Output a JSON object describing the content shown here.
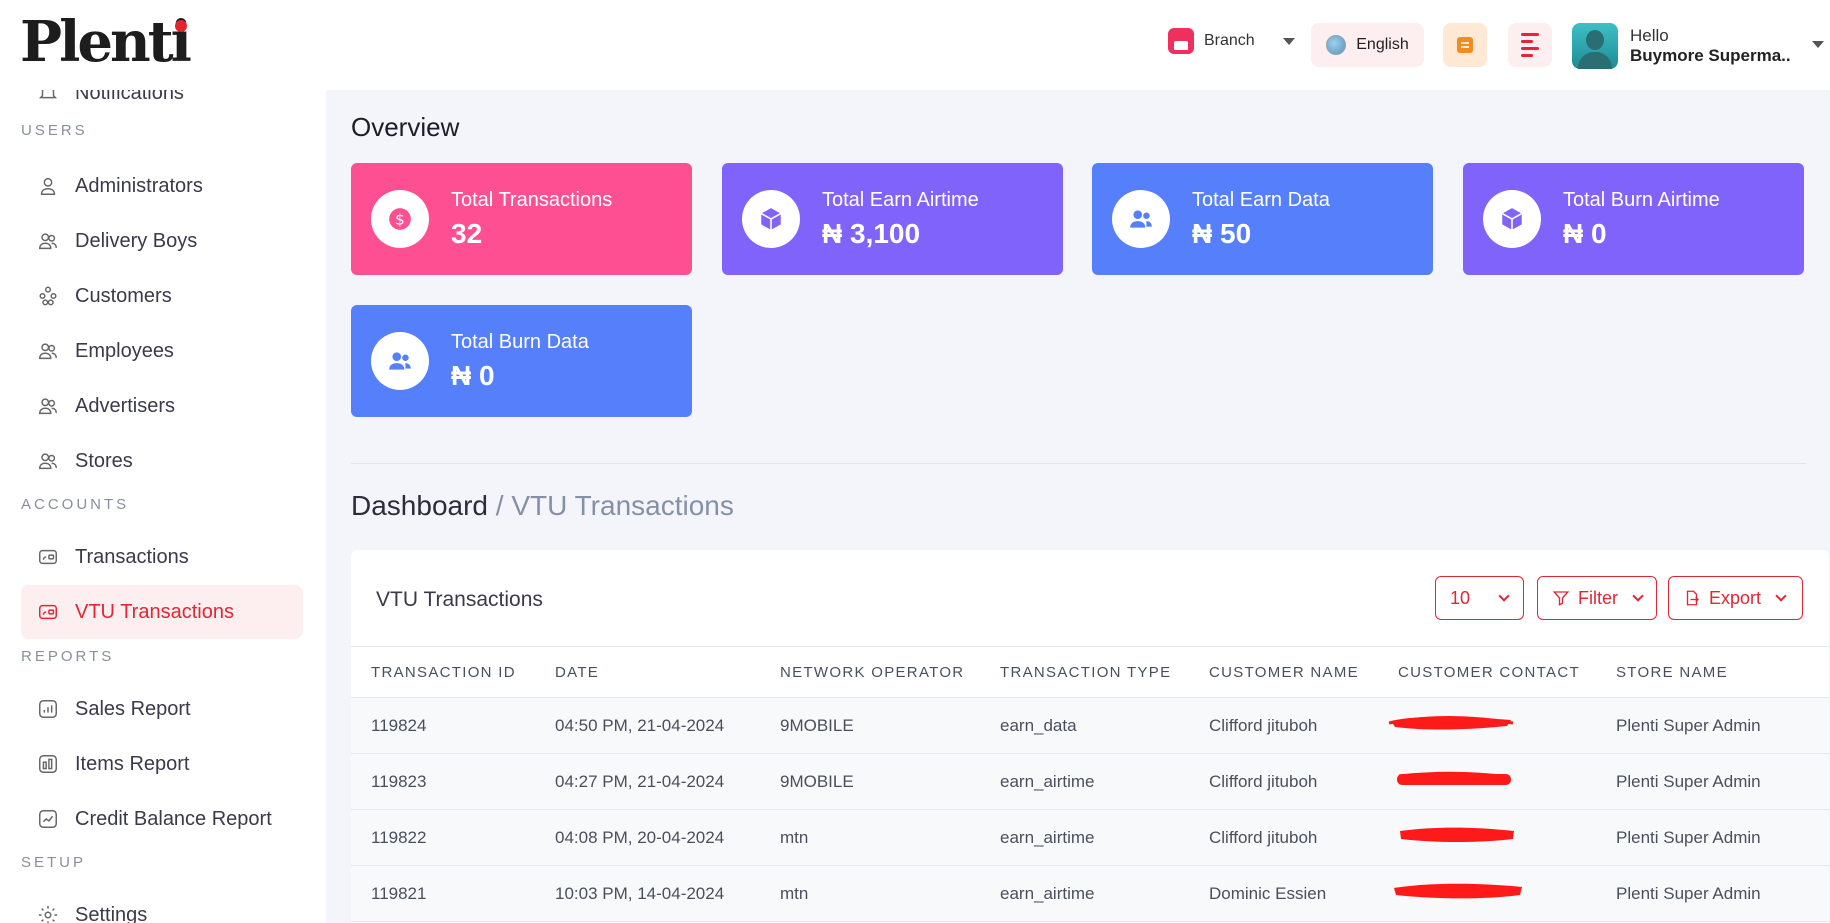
{
  "header": {
    "logo_text": "Plenti",
    "branch_label": "Branch",
    "language_label": "English",
    "user_greeting": "Hello",
    "user_name": "Buymore Superma.."
  },
  "sidebar": {
    "partial_top_item": "Notifications",
    "sections": [
      {
        "title": "USERS",
        "items": [
          "Administrators",
          "Delivery Boys",
          "Customers",
          "Employees",
          "Advertisers",
          "Stores"
        ]
      },
      {
        "title": "ACCOUNTS",
        "items": [
          "Transactions",
          "VTU Transactions"
        ]
      },
      {
        "title": "REPORTS",
        "items": [
          "Sales Report",
          "Items Report",
          "Credit Balance Report"
        ]
      },
      {
        "title": "SETUP",
        "items": [
          "Settings"
        ]
      }
    ],
    "active_item": "VTU Transactions"
  },
  "overview": {
    "title": "Overview",
    "cards": [
      {
        "label": "Total Transactions",
        "value": "32",
        "color": "#ff4f93",
        "icon": "dollar-icon"
      },
      {
        "label": "Total Earn Airtime",
        "value": "₦ 3,100",
        "color": "#8063fb",
        "icon": "box-icon"
      },
      {
        "label": "Total Earn Data",
        "value": "₦ 50",
        "color": "#5680fb",
        "icon": "users-icon"
      },
      {
        "label": "Total Burn Airtime",
        "value": "₦ 0",
        "color": "#8063fb",
        "icon": "box-icon"
      },
      {
        "label": "Total Burn Data",
        "value": "₦ 0",
        "color": "#5680fb",
        "icon": "users-icon"
      }
    ]
  },
  "breadcrumb": {
    "root": "Dashboard",
    "separator": "/",
    "current": "VTU Transactions"
  },
  "table": {
    "title": "VTU Transactions",
    "page_size": "10",
    "filter_label": "Filter",
    "export_label": "Export",
    "columns": [
      "TRANSACTION ID",
      "DATE",
      "NETWORK OPERATOR",
      "TRANSACTION TYPE",
      "CUSTOMER NAME",
      "CUSTOMER CONTACT",
      "STORE NAME"
    ],
    "rows": [
      {
        "id": "119824",
        "date": "04:50 PM, 21-04-2024",
        "operator": "9MOBILE",
        "type": "earn_data",
        "customer": "Clifford jituboh",
        "store": "Plenti Super Admin"
      },
      {
        "id": "119823",
        "date": "04:27 PM, 21-04-2024",
        "operator": "9MOBILE",
        "type": "earn_airtime",
        "customer": "Clifford jituboh",
        "store": "Plenti Super Admin"
      },
      {
        "id": "119822",
        "date": "04:08 PM, 20-04-2024",
        "operator": "mtn",
        "type": "earn_airtime",
        "customer": "Clifford jituboh",
        "store": "Plenti Super Admin"
      },
      {
        "id": "119821",
        "date": "10:03 PM, 14-04-2024",
        "operator": "mtn",
        "type": "earn_airtime",
        "customer": "Dominic Essien",
        "store": "Plenti Super Admin"
      }
    ]
  },
  "colors": {
    "accent": "#e32636",
    "active_bg": "#fdeef0",
    "page_bg": "#f4f5fa"
  }
}
